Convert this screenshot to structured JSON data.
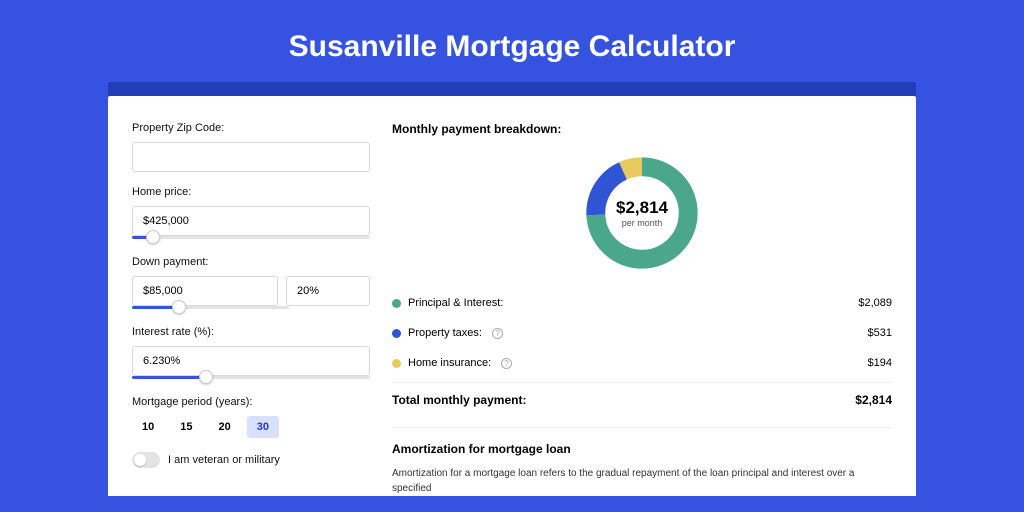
{
  "title": "Susanville Mortgage Calculator",
  "form": {
    "zip": {
      "label": "Property Zip Code:",
      "value": ""
    },
    "home_price": {
      "label": "Home price:",
      "value": "$425,000",
      "slider_pct": 9
    },
    "down_payment": {
      "label": "Down payment:",
      "amount": "$85,000",
      "percent": "20%",
      "slider_pct": 20
    },
    "interest": {
      "label": "Interest rate (%):",
      "value": "6.230%",
      "slider_pct": 31
    },
    "period": {
      "label": "Mortgage period (years):",
      "options": [
        "10",
        "15",
        "20",
        "30"
      ],
      "active_index": 3
    },
    "veteran": {
      "label": "I am veteran or military",
      "checked": false
    }
  },
  "breakdown": {
    "title": "Monthly payment breakdown:",
    "donut": {
      "amount": "$2,814",
      "sub": "per month",
      "segments": [
        {
          "color": "#4aa789",
          "fraction": 0.742
        },
        {
          "color": "#2f55d4",
          "fraction": 0.189
        },
        {
          "color": "#e8c95d",
          "fraction": 0.069
        }
      ]
    },
    "items": [
      {
        "color": "green",
        "label": "Principal & Interest:",
        "has_info": false,
        "value": "$2,089"
      },
      {
        "color": "blue",
        "label": "Property taxes:",
        "has_info": true,
        "value": "$531"
      },
      {
        "color": "yellow",
        "label": "Home insurance:",
        "has_info": true,
        "value": "$194"
      }
    ],
    "total": {
      "label": "Total monthly payment:",
      "value": "$2,814"
    }
  },
  "amortization": {
    "title": "Amortization for mortgage loan",
    "text": "Amortization for a mortgage loan refers to the gradual repayment of the loan principal and interest over a specified"
  },
  "chart_data": {
    "type": "pie",
    "title": "Monthly payment breakdown",
    "categories": [
      "Principal & Interest",
      "Property taxes",
      "Home insurance"
    ],
    "values": [
      2089,
      531,
      194
    ],
    "total": 2814,
    "unit": "USD per month"
  }
}
